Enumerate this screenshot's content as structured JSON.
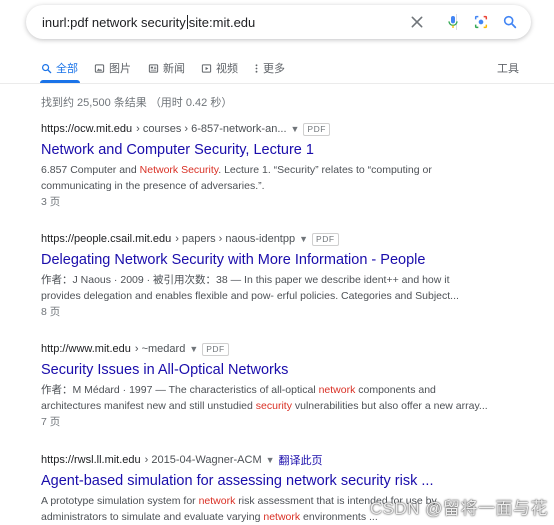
{
  "search": {
    "query_before_caret": "inurl:pdf network security",
    "query_after_caret": "site:mit.edu"
  },
  "tabs": [
    {
      "label": "全部",
      "icon": "search-icon",
      "active": true
    },
    {
      "label": "图片",
      "icon": "image-icon"
    },
    {
      "label": "新闻",
      "icon": "news-icon"
    },
    {
      "label": "视频",
      "icon": "video-icon"
    },
    {
      "label": "更多",
      "icon": "more-vert-icon"
    }
  ],
  "tools_label": "工具",
  "stats": "找到约 25,500 条结果 （用时 0.42 秒）",
  "results": [
    {
      "site": "https://ocw.mit.edu",
      "path": " › courses › 6-857-network-an...",
      "badge": "PDF",
      "title": "Network and Computer Security, Lecture 1",
      "snippet_line1": [
        {
          "t": "6.857 Computer and "
        },
        {
          "t": "Network Security",
          "hl": true
        },
        {
          "t": ". Lecture 1. “Security” relates to “computing or"
        }
      ],
      "snippet_line2": [
        {
          "t": "communicating in the presence of adversaries.”."
        }
      ],
      "pages": "3 页"
    },
    {
      "site": "https://people.csail.mit.edu",
      "path": " › papers › naous-identpp",
      "badge": "PDF",
      "title": "Delegating Network Security with More Information - People",
      "snippet_line1": [
        {
          "t": "作者：J Naous · 2009 · 被引用次数：38 — In this paper we describe ident++ and how it"
        }
      ],
      "snippet_line2": [
        {
          "t": "provides delegation and enables flexible and pow- erful policies. Categories and Subject..."
        }
      ],
      "pages": "8 页"
    },
    {
      "site": "http://www.mit.edu",
      "path": " › ~medard",
      "badge": "PDF",
      "title": "Security Issues in All-Optical Networks",
      "snippet_line1": [
        {
          "t": "作者：M Médard · 1997 — The characteristics of all-optical "
        },
        {
          "t": "network",
          "hl": true
        },
        {
          "t": " components and"
        }
      ],
      "snippet_line2": [
        {
          "t": "architectures manifest new and still unstudied "
        },
        {
          "t": "security",
          "hl": true
        },
        {
          "t": " vulnerabilities but also offer a new array..."
        }
      ],
      "pages": "7 页"
    },
    {
      "site": "https://rwsl.ll.mit.edu",
      "path": " › 2015-04-Wagner-ACM",
      "translate": "翻译此页",
      "title": "Agent-based simulation for assessing network security risk ...",
      "snippet_line1": [
        {
          "t": "A prototype simulation system for "
        },
        {
          "t": "network",
          "hl": true
        },
        {
          "t": " risk assessment that is intended for use by"
        }
      ],
      "snippet_line2": [
        {
          "t": "administrators to simulate and evaluate varying "
        },
        {
          "t": "network",
          "hl": true
        },
        {
          "t": " environments ..."
        }
      ]
    }
  ],
  "watermark": "CSDN @留将一面与花",
  "colors": {
    "link": "#1a0dab",
    "highlight": "#d93025",
    "accent": "#1a73e8",
    "snippet": "#4d5156",
    "muted": "#70757a"
  }
}
